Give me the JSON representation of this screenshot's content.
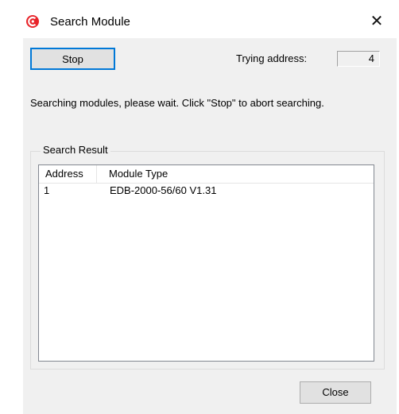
{
  "window": {
    "title": "Search Module",
    "close_glyph": "✕",
    "icon": "app-logo-icon"
  },
  "toolbar": {
    "stop_label": "Stop",
    "trying_label": "Trying address:",
    "trying_value": "4"
  },
  "status": {
    "message": "Searching modules, please wait.  Click \"Stop\" to abort searching."
  },
  "results": {
    "group_title": "Search Result",
    "columns": [
      "Address",
      "Module Type"
    ],
    "rows": [
      {
        "address": "1",
        "module_type": "EDB-2000-56/60 V1.31"
      }
    ]
  },
  "footer": {
    "close_label": "Close"
  },
  "colors": {
    "accent": "#0078d7",
    "logo": "#e8242a"
  }
}
